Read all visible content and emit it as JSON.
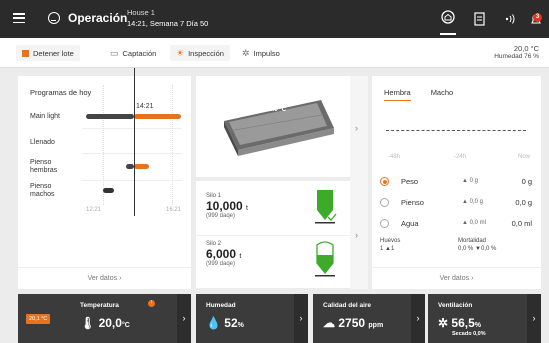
{
  "header": {
    "title": "Operación",
    "house": "House 1",
    "datetime": "14:21, Semana 7 Día 50",
    "bell_count": "3"
  },
  "toolbar": {
    "stop_label": "Detener lote",
    "captacion_label": "Captación",
    "inspeccion_label": "Inspección",
    "impulso_label": "Impulso",
    "temp": "20,0 °C",
    "humidity": "Humedad 76 %"
  },
  "programs": {
    "title": "Programas de hoy",
    "items": [
      "Main light",
      "Llenado",
      "Pienso hembras",
      "Pienso machos"
    ],
    "now_time": "14:21",
    "axis_start": "12:21",
    "axis_end": "16:21",
    "view_link": "Ver datos"
  },
  "house_view": {
    "temp_label": "20.0 °C"
  },
  "silos": [
    {
      "name": "Silo 1",
      "amount": "10,000",
      "unit": "t",
      "days": "(999 daqe)"
    },
    {
      "name": "Silo 2",
      "amount": "6,000",
      "unit": "t",
      "days": "(999 daqe)"
    }
  ],
  "weights": {
    "tab_female": "Hembra",
    "tab_male": "Macho",
    "axis": [
      "-48h",
      "-24h",
      "Now"
    ],
    "rows": [
      {
        "label": "Peso",
        "delta": "▲ 0 g",
        "value": "0 g"
      },
      {
        "label": "Pienso",
        "delta": "▲ 0,0 g",
        "value": "0,0 g"
      },
      {
        "label": "Agua",
        "delta": "▲ 0,0 ml",
        "value": "0,0 ml"
      }
    ],
    "eggs_label": "Huevos",
    "eggs_values": "1   ▲1",
    "mortality_label": "Mortalidad",
    "mortality_values": "0,0 %  ▼0,0 %",
    "view_link": "Ver datos"
  },
  "bottom": {
    "temp_label": "Temperatura",
    "temp_flag": "20,1 °C",
    "temp_value": "20,0",
    "temp_unit": "°C",
    "hum_label": "Humedad",
    "hum_value": "52",
    "hum_unit": "%",
    "air_label": "Calidad del aire",
    "air_value": "2750",
    "air_unit": "ppm",
    "vent_label": "Ventilación",
    "vent_value": "56,5",
    "vent_unit": "%",
    "vent_sub": "Secado 0,0%"
  }
}
